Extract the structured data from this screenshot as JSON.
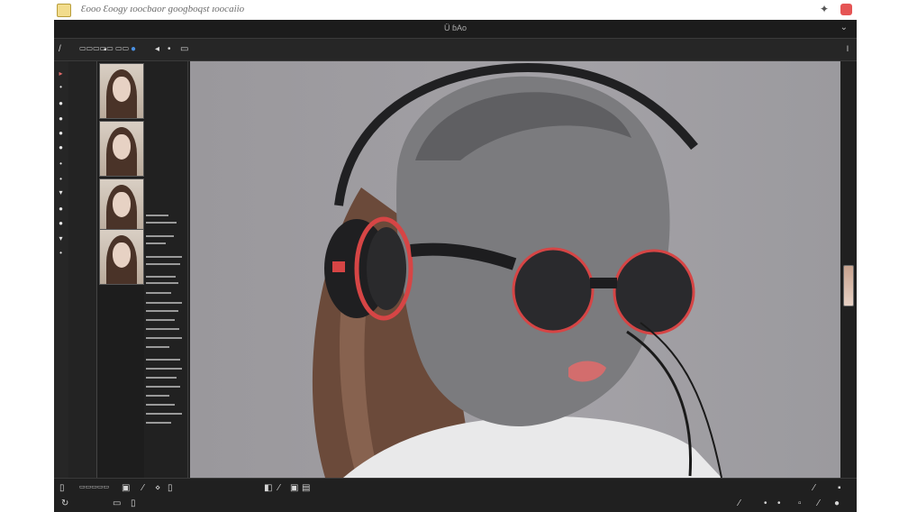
{
  "os_bar": {
    "app_title": "Ԑooo Ԑoogy ɪoocbaor ɡooɡboqst ɪoocaiio",
    "pin_icon": "pin-icon",
    "close_icon": "close-icon"
  },
  "window": {
    "title": "Ü ɓAo",
    "options_label": "▭▭▭▭▭ ▭▭",
    "status_label": "▭▭▭▭▭"
  },
  "tool_icons": [
    "brush-icon",
    "eraser-icon",
    "dodge-icon",
    "burn-icon",
    "blur-icon",
    "smudge-icon",
    "pen-icon",
    "type-icon",
    "shape-icon",
    "eyedropper-icon",
    "hand-icon",
    "zoom-icon"
  ],
  "thumbnails_count": 4,
  "colors": {
    "window": "#232323",
    "canvas": "#9d9ca0",
    "accent_red": "#d64545",
    "app_icon": "#f2dc8c"
  }
}
